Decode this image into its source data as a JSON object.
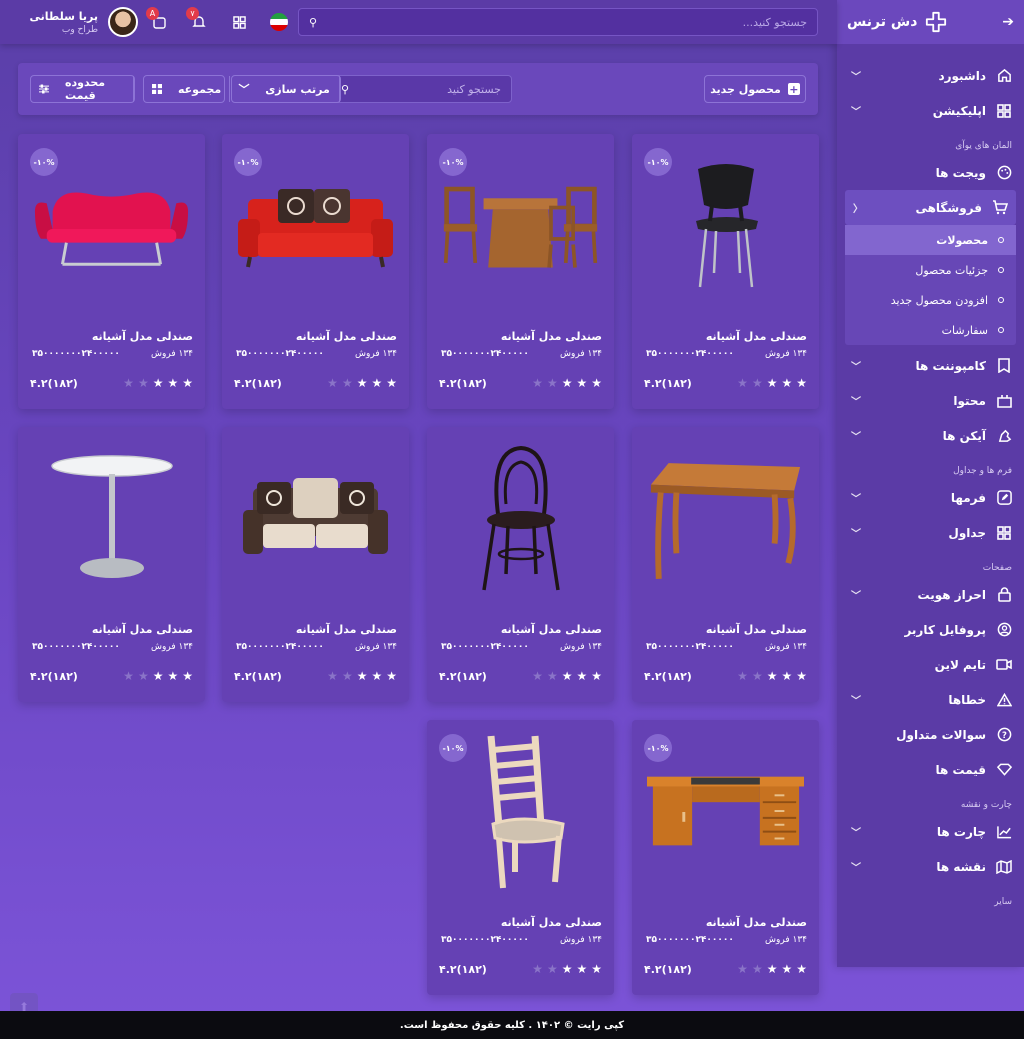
{
  "brand": {
    "name": "دش ترنس"
  },
  "topbar": {
    "search_placeholder": "جستجو کنید...",
    "user": {
      "name": "پریا سلطانی",
      "role": "طراح وب"
    },
    "icons": {
      "flag": "iran-flag",
      "apps": "grid-icon",
      "notifications_badge": "۷",
      "translate_badge": "A"
    }
  },
  "sidebar": {
    "items": [
      {
        "label": "داشبورد",
        "icon": "home-icon",
        "chevron": true
      },
      {
        "label": "اپلیکیشن",
        "icon": "apps-icon",
        "chevron": true
      }
    ],
    "section_ui": "المان های یوآی",
    "widgets": {
      "label": "ویجت ها",
      "icon": "palette-icon"
    },
    "shop": {
      "label": "فروشگاهی",
      "icon": "cart-icon",
      "sub": [
        {
          "label": "محصولات",
          "active": true
        },
        {
          "label": "جزئیات محصول"
        },
        {
          "label": "افزودن محصول جدید"
        },
        {
          "label": "سفارشات"
        }
      ]
    },
    "items2": [
      {
        "label": "کامپوننت ها",
        "icon": "bookmark-icon"
      },
      {
        "label": "محتوا",
        "icon": "box-icon"
      },
      {
        "label": "آیکن ها",
        "icon": "hand-icon"
      }
    ],
    "section_forms": "فرم ها و جداول",
    "items3": [
      {
        "label": "فرمها",
        "icon": "edit-icon"
      },
      {
        "label": "جداول",
        "icon": "table-icon"
      }
    ],
    "section_pages": "صفحات",
    "items4": [
      {
        "label": "احراز هویت",
        "icon": "lock-icon",
        "chevron": true
      },
      {
        "label": "پروفایل کاربر",
        "icon": "user-icon",
        "chevron": false
      },
      {
        "label": "تایم لاین",
        "icon": "camera-icon",
        "chevron": false
      },
      {
        "label": "خطاها",
        "icon": "warning-icon",
        "chevron": true
      },
      {
        "label": "سوالات متداول",
        "icon": "question-icon",
        "chevron": false
      },
      {
        "label": "قیمت ها",
        "icon": "diamond-icon",
        "chevron": false
      }
    ],
    "section_charts": "چارت و نقشه",
    "items5": [
      {
        "label": "چارت ها",
        "icon": "chart-icon"
      },
      {
        "label": "نقشه ها",
        "icon": "map-icon"
      }
    ],
    "section_other": "سایر"
  },
  "toolbar": {
    "new_product": "محصول جدید",
    "search_placeholder": "جستجو کنید",
    "sort": "مرتب سازی",
    "set": "مجموعه",
    "price_range": "محدوده قیمت"
  },
  "products": [
    {
      "title": "صندلی مدل آشیانه",
      "discount": "-۱۰%",
      "sold": "۱۳۴ فروش",
      "price": "۳۵۰۰۰۰۰۰۰۲۴۰۰۰۰۰",
      "rating": "(۱۸۲)۴.۲",
      "stars": 3,
      "image": "black-chair"
    },
    {
      "title": "صندلی مدل آشیانه",
      "discount": "-۱۰%",
      "sold": "۱۳۴ فروش",
      "price": "۳۵۰۰۰۰۰۰۰۲۴۰۰۰۰۰",
      "rating": "(۱۸۲)۴.۲",
      "stars": 3,
      "image": "dining-set"
    },
    {
      "title": "صندلی مدل آشیانه",
      "discount": "-۱۰%",
      "sold": "۱۳۴ فروش",
      "price": "۳۵۰۰۰۰۰۰۰۲۴۰۰۰۰۰",
      "rating": "(۱۸۲)۴.۲",
      "stars": 3,
      "image": "red-sofa"
    },
    {
      "title": "صندلی مدل آشیانه",
      "discount": "-۱۰%",
      "sold": "۱۳۴ فروش",
      "price": "۳۵۰۰۰۰۰۰۰۲۴۰۰۰۰۰",
      "rating": "(۱۸۲)۴.۲",
      "stars": 3,
      "image": "pink-loveseat"
    },
    {
      "title": "صندلی مدل آشیانه",
      "sold": "۱۳۴ فروش",
      "price": "۳۵۰۰۰۰۰۰۰۲۴۰۰۰۰۰",
      "rating": "(۱۸۲)۴.۲",
      "stars": 3,
      "image": "wood-table"
    },
    {
      "title": "صندلی مدل آشیانه",
      "sold": "۱۳۴ فروش",
      "price": "۳۵۰۰۰۰۰۰۰۲۴۰۰۰۰۰",
      "rating": "(۱۸۲)۴.۲",
      "stars": 3,
      "image": "bentwood-chair"
    },
    {
      "title": "صندلی مدل آشیانه",
      "sold": "۱۳۴ فروش",
      "price": "۳۵۰۰۰۰۰۰۰۲۴۰۰۰۰۰",
      "rating": "(۱۸۲)۴.۲",
      "stars": 3,
      "image": "brown-sofa"
    },
    {
      "title": "صندلی مدل آشیانه",
      "sold": "۱۳۴ فروش",
      "price": "۳۵۰۰۰۰۰۰۰۲۴۰۰۰۰۰",
      "rating": "(۱۸۲)۴.۲",
      "stars": 3,
      "image": "round-table"
    },
    {
      "title": "صندلی مدل آشیانه",
      "discount": "-۱۰%",
      "sold": "۱۳۴ فروش",
      "price": "۳۵۰۰۰۰۰۰۰۲۴۰۰۰۰۰",
      "rating": "(۱۸۲)۴.۲",
      "stars": 3,
      "image": "desk"
    },
    {
      "title": "صندلی مدل آشیانه",
      "discount": "-۱۰%",
      "sold": "۱۳۴ فروش",
      "price": "۳۵۰۰۰۰۰۰۰۲۴۰۰۰۰۰",
      "rating": "(۱۸۲)۴.۲",
      "stars": 3,
      "image": "ladder-chair"
    }
  ],
  "footer": {
    "copyright": "کپی رایت © ۱۴۰۲ . کلیه حقوق محفوظ است."
  }
}
